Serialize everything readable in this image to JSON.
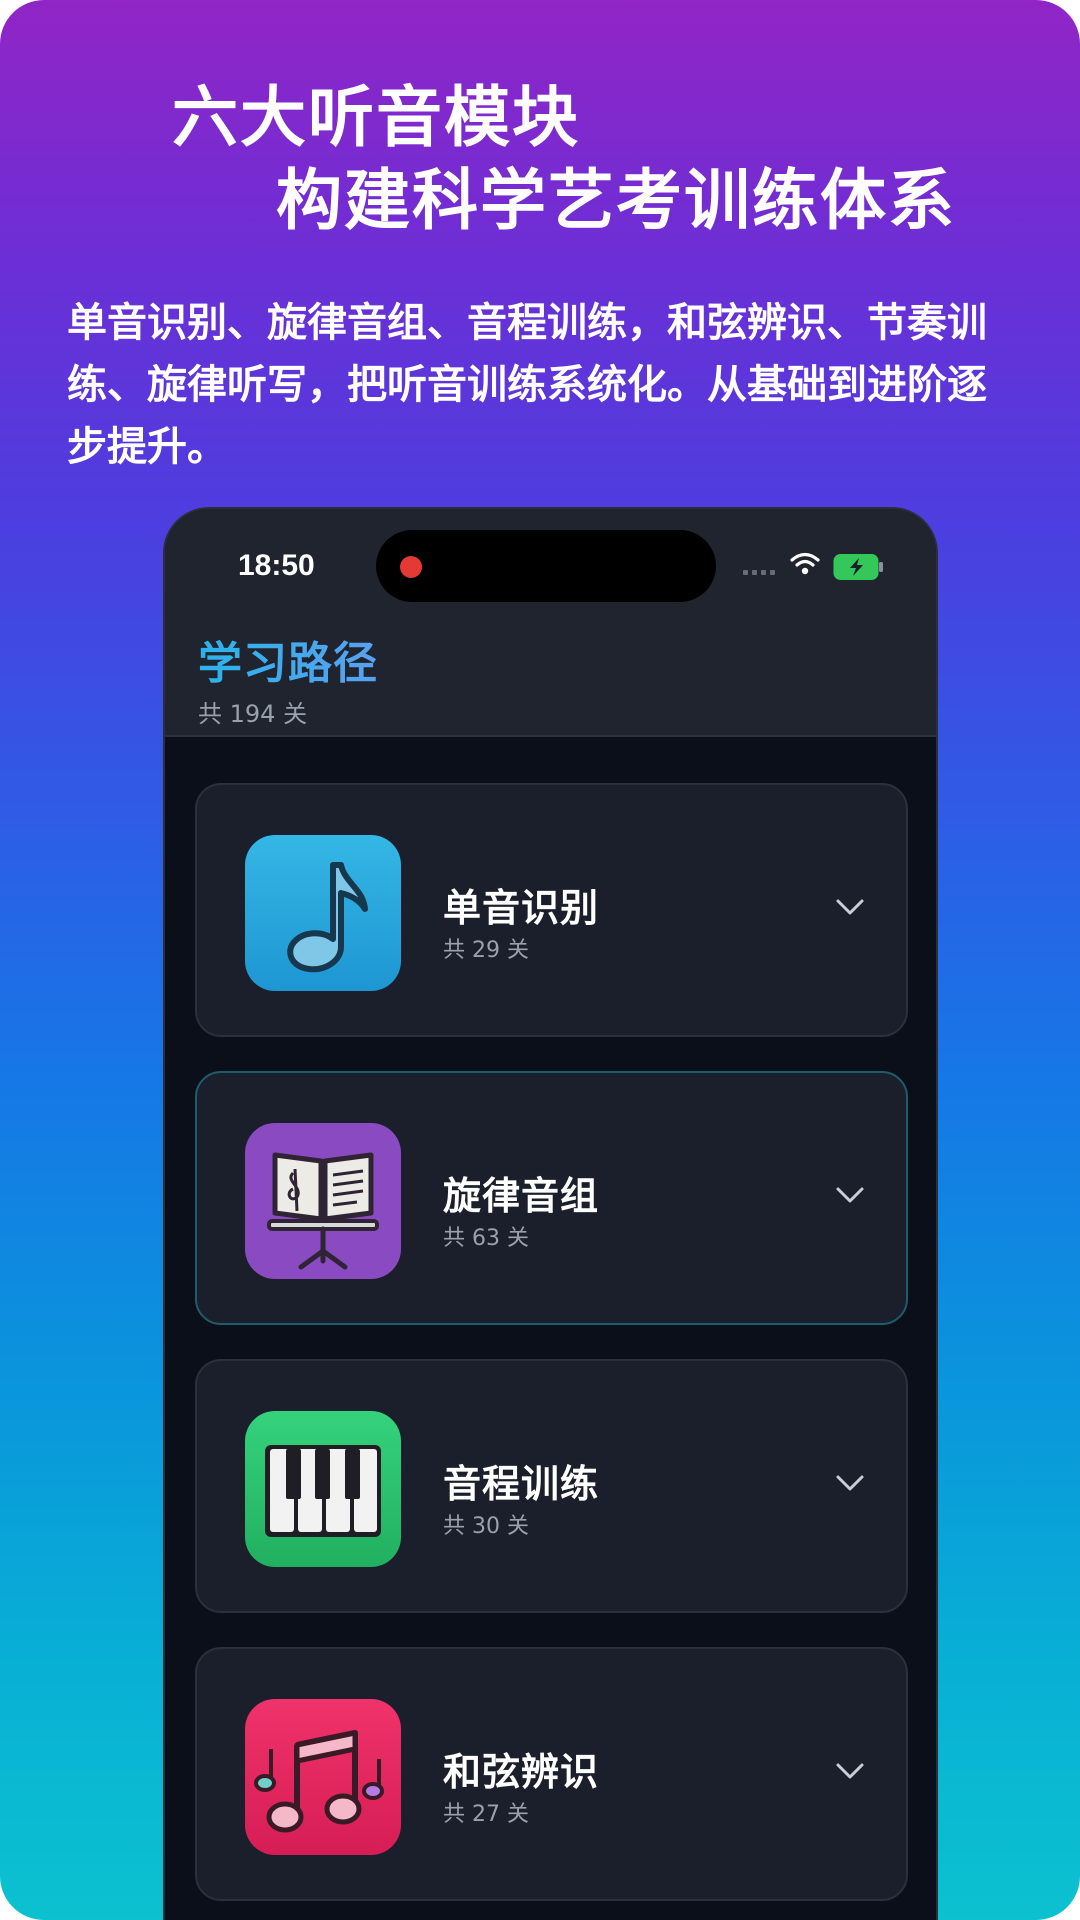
{
  "headline": {
    "line1": "六大听音模块",
    "line2": "构建科学艺考训练体系"
  },
  "description": "单音识别、旋律音组、音程训练，和弦辨识、节奏训练、旋律听写，把听音训练系统化。从基础到进阶逐步提升。",
  "status_bar": {
    "time": "18:50"
  },
  "header": {
    "title": "学习路径",
    "subtitle": "共 194 关"
  },
  "modules": [
    {
      "name": "单音识别",
      "count": "共 29 关",
      "icon": "music-note-icon",
      "color": "#2aa9de"
    },
    {
      "name": "旋律音组",
      "count": "共 63 关",
      "icon": "music-stand-icon",
      "color": "#8a4bc2"
    },
    {
      "name": "音程训练",
      "count": "共 30 关",
      "icon": "piano-icon",
      "color": "#2bc06a"
    },
    {
      "name": "和弦辨识",
      "count": "共 27 关",
      "icon": "music-notes-icon",
      "color": "#e0245e"
    }
  ]
}
